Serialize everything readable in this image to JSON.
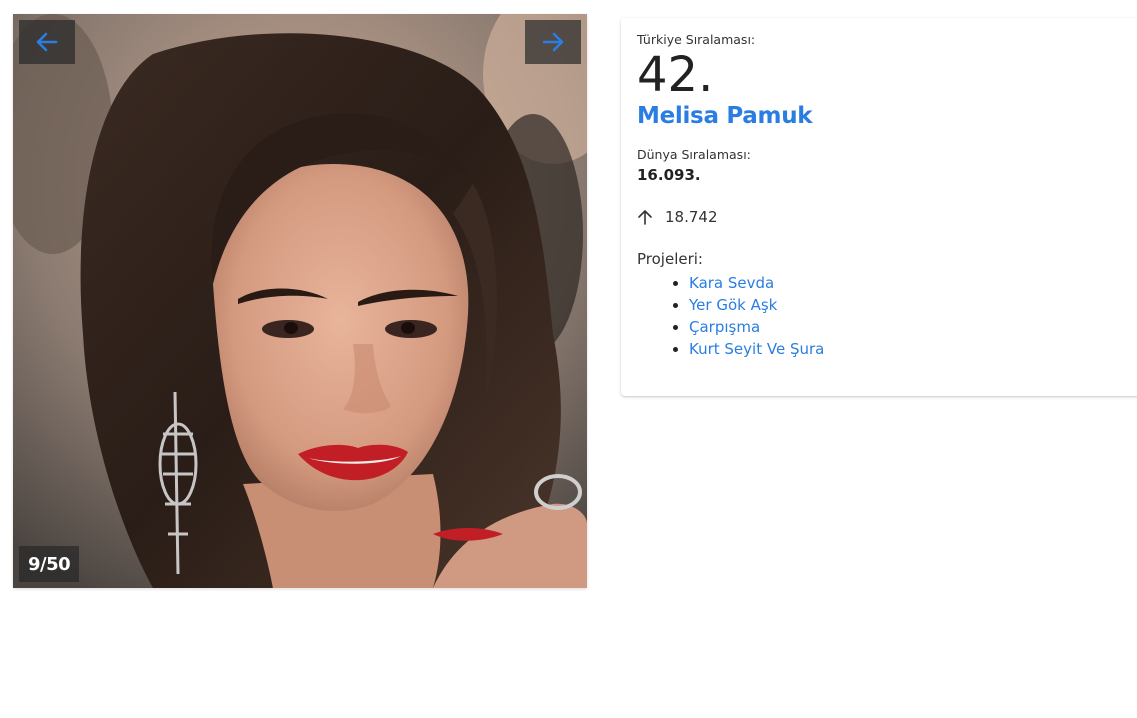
{
  "gallery": {
    "counter": "9/50",
    "prev_icon": "arrow-left-icon",
    "next_icon": "arrow-right-icon",
    "accent": "#2a7de1"
  },
  "profile": {
    "turkey_rank_label": "Türkiye Sıralaması:",
    "turkey_rank": "42.",
    "name": "Melisa Pamuk",
    "world_rank_label": "Dünya Sıralaması:",
    "world_rank": "16.093.",
    "trend_icon": "arrow-up-icon",
    "trend_value": "18.742",
    "projects_label": "Projeleri:",
    "projects": [
      "Kara Sevda",
      "Yer Gök Aşk",
      "Çarpışma",
      "Kurt Seyit Ve Şura"
    ]
  }
}
